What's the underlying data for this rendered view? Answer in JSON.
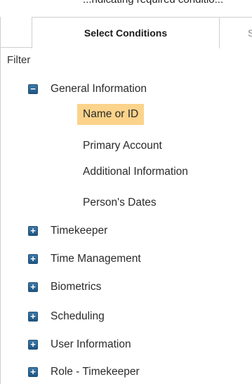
{
  "top_text": "...ndicating required conditio...",
  "tabs": [
    {
      "label": "Select Conditions"
    },
    {
      "label": "S"
    }
  ],
  "filter_label": "Filter",
  "tree": {
    "general_information": {
      "label": "General Information",
      "expanded": true,
      "children": [
        "Name or ID",
        "Primary Account",
        "Additional Information",
        "Person's Dates"
      ],
      "selected_child": "Name or ID"
    },
    "collapsed": [
      "Timekeeper",
      "Time Management",
      "Biometrics",
      "Scheduling",
      "User Information",
      "Role - Timekeeper"
    ]
  },
  "icons": {
    "collapse": "minus-box-icon",
    "expand": "plus-box-icon"
  },
  "colors": {
    "selected_highlight": "#fbd38a",
    "expander_blue": "#2a6494",
    "tab_border": "#cfcfcf"
  }
}
